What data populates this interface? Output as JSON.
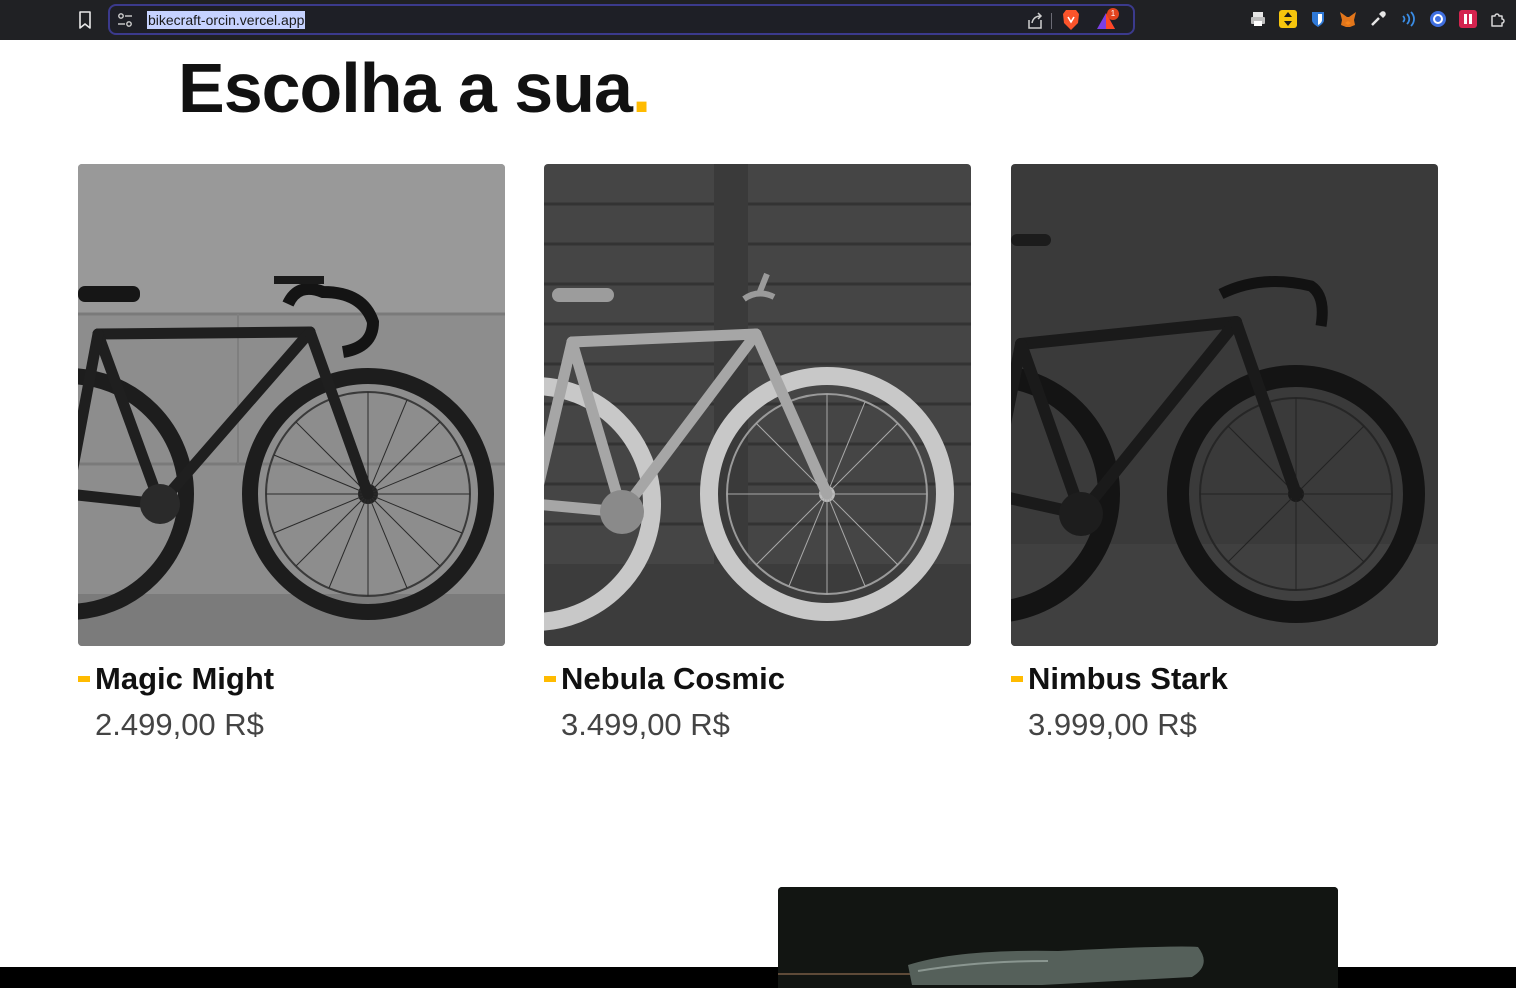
{
  "browser": {
    "url": "bikecraft-orcin.vercel.app",
    "rewards_badge": "1",
    "extensions": [
      "printer-icon",
      "arrows-extension-icon",
      "bitwarden-icon",
      "metamask-fox-icon",
      "eyedropper-icon",
      "wireless-extension-icon",
      "blue-circle-extension-icon",
      "red-extension-icon",
      "puzzle-extensions-icon"
    ]
  },
  "page": {
    "title": "Escolha a sua",
    "title_dot": ".",
    "accent_color": "#ffbb00",
    "products": [
      {
        "name": "Magic Might",
        "price": "2.499,00 R$"
      },
      {
        "name": "Nebula Cosmic",
        "price": "3.499,00 R$"
      },
      {
        "name": "Nimbus Stark",
        "price": "3.999,00 R$"
      }
    ]
  }
}
